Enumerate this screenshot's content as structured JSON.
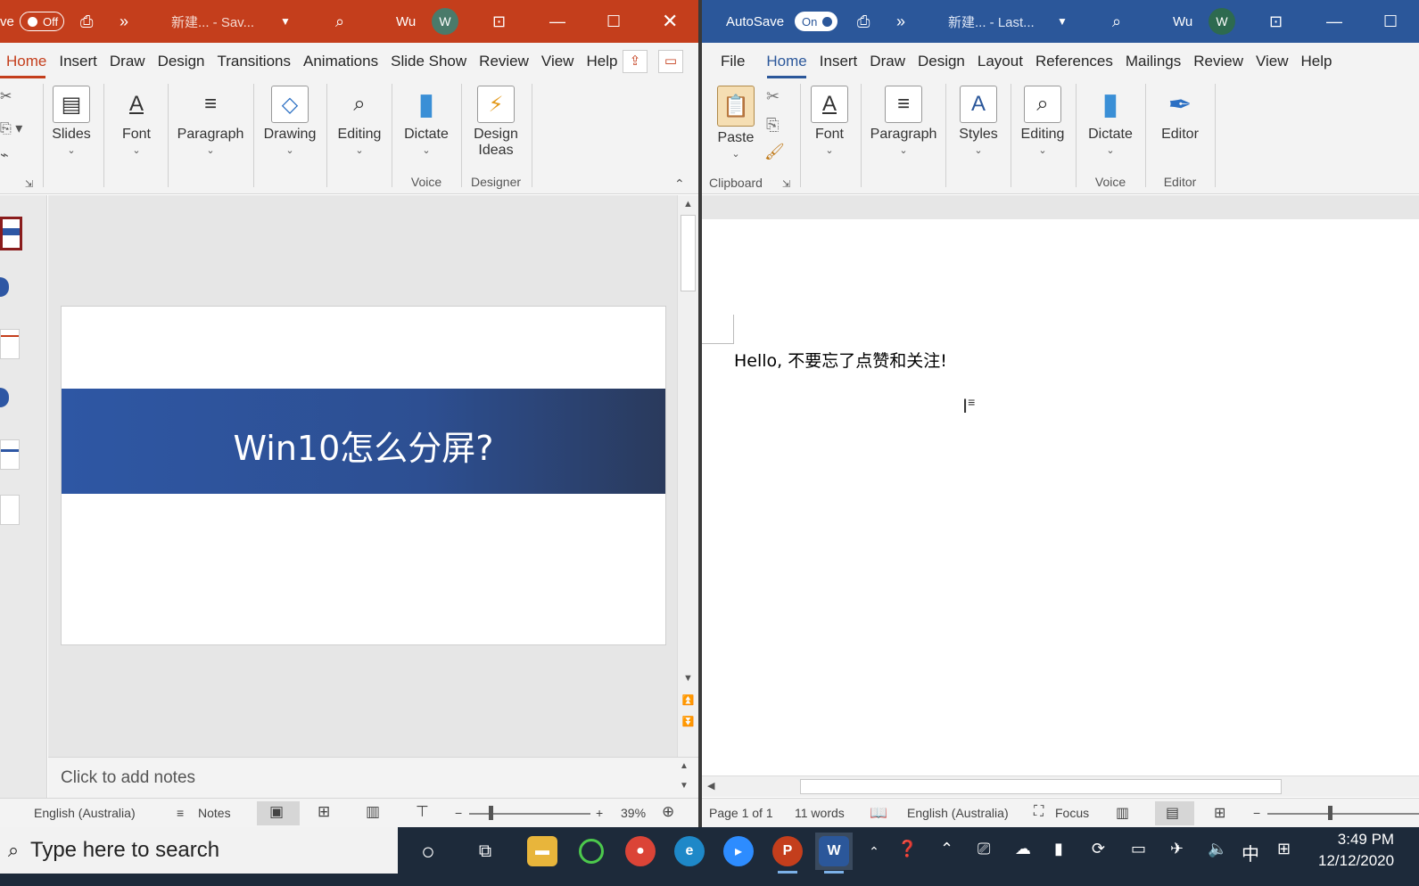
{
  "ppt": {
    "titlebar": {
      "autosave_fragment": "ve",
      "autosave_state": "Off",
      "more": "»",
      "doc_title": "新建...  - Sav...",
      "user": "Wu",
      "avatar": "W"
    },
    "tabs": [
      "Home",
      "Insert",
      "Draw",
      "Design",
      "Transitions",
      "Animations",
      "Slide Show",
      "Review",
      "View",
      "Help"
    ],
    "ribbon": {
      "slides": "Slides",
      "font": "Font",
      "paragraph": "Paragraph",
      "drawing": "Drawing",
      "editing": "Editing",
      "dictate": "Dictate",
      "design_ideas_1": "Design",
      "design_ideas_2": "Ideas",
      "group_voice": "Voice",
      "group_designer": "Designer"
    },
    "slide_title": "Win10怎么分屏?",
    "notes_placeholder": "Click to add notes",
    "status": {
      "language": "English (Australia)",
      "notes": "Notes",
      "zoom_minus": "−",
      "zoom_plus": "+",
      "zoom": "39%"
    }
  },
  "word": {
    "titlebar": {
      "autosave": "AutoSave",
      "autosave_state": "On",
      "more": "»",
      "doc_title": "新建...  - Last...",
      "user": "Wu",
      "avatar": "W"
    },
    "tabs": [
      "File",
      "Home",
      "Insert",
      "Draw",
      "Design",
      "Layout",
      "References",
      "Mailings",
      "Review",
      "View",
      "Help"
    ],
    "ribbon": {
      "paste": "Paste",
      "font": "Font",
      "paragraph": "Paragraph",
      "styles": "Styles",
      "editing": "Editing",
      "dictate": "Dictate",
      "editor": "Editor",
      "group_clipboard": "Clipboard",
      "group_voice": "Voice",
      "group_editor": "Editor"
    },
    "document_text": "Hello, 不要忘了点赞和关注!",
    "status": {
      "page": "Page 1 of 1",
      "words": "11 words",
      "language": "English (Australia)",
      "focus": "Focus",
      "zoom_minus": "−"
    }
  },
  "taskbar": {
    "search_placeholder": "Type here to search",
    "ime": "中",
    "time": "3:49 PM",
    "date": "12/12/2020"
  }
}
